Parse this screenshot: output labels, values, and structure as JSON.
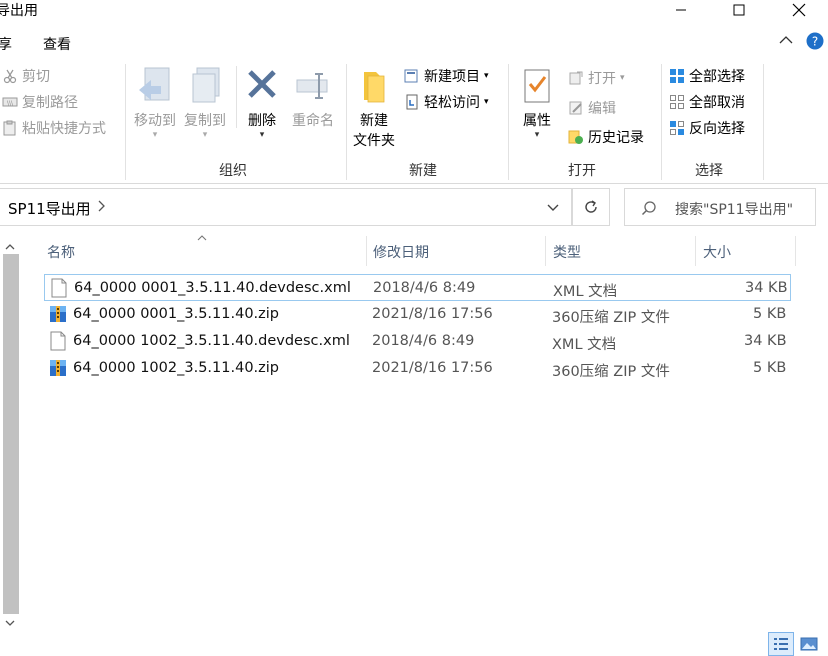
{
  "window": {
    "title": "导出用"
  },
  "menu": {
    "share": "享",
    "view": "查看"
  },
  "ribbon": {
    "clipboard": {
      "cut": "剪切",
      "copy_path": "复制路径",
      "paste_shortcut": "粘贴快捷方式"
    },
    "organize": {
      "move_to": "移动到",
      "copy_to": "复制到",
      "delete": "删除",
      "rename": "重命名",
      "label": "组织"
    },
    "new": {
      "new_folder_1": "新建",
      "new_folder_2": "文件夹",
      "new_item": "新建项目",
      "easy_access": "轻松访问",
      "label": "新建"
    },
    "open": {
      "properties": "属性",
      "open": "打开",
      "edit": "编辑",
      "history": "历史记录",
      "label": "打开"
    },
    "select": {
      "select_all": "全部选择",
      "select_none": "全部取消",
      "invert": "反向选择",
      "label": "选择"
    }
  },
  "address": {
    "path": "SP11导出用"
  },
  "search": {
    "placeholder": "搜索\"SP11导出用\""
  },
  "columns": {
    "name": "名称",
    "modified": "修改日期",
    "type": "类型",
    "size": "大小"
  },
  "files": [
    {
      "name": "64_0000 0001_3.5.11.40.devdesc.xml",
      "modified": "2018/4/6 8:49",
      "type": "XML 文档",
      "size": "34 KB",
      "icon": "xml-file-icon"
    },
    {
      "name": "64_0000 0001_3.5.11.40.zip",
      "modified": "2021/8/16 17:56",
      "type": "360压缩 ZIP 文件",
      "size": "5 KB",
      "icon": "zip-file-icon"
    },
    {
      "name": "64_0000 1002_3.5.11.40.devdesc.xml",
      "modified": "2018/4/6 8:49",
      "type": "XML 文档",
      "size": "34 KB",
      "icon": "xml-file-icon"
    },
    {
      "name": "64_0000 1002_3.5.11.40.zip",
      "modified": "2021/8/16 17:56",
      "type": "360压缩 ZIP 文件",
      "size": "5 KB",
      "icon": "zip-file-icon"
    }
  ],
  "colors": {
    "accent": "#0078d7",
    "selection_border": "#99c9ef",
    "header_text": "#4c607a"
  }
}
